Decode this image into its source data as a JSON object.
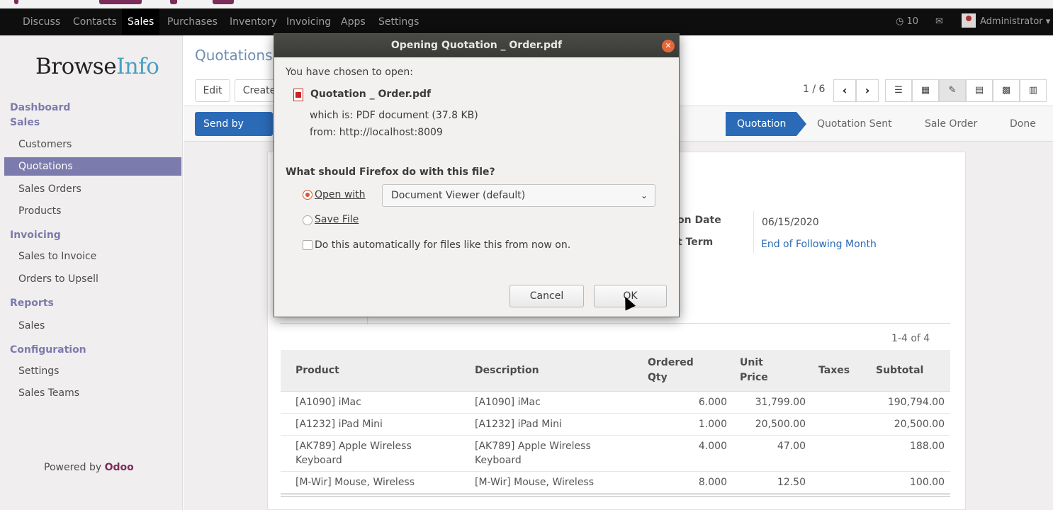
{
  "navbar": {
    "items": [
      "Discuss",
      "Contacts",
      "Sales",
      "Purchases",
      "Inventory",
      "Invoicing",
      "Apps",
      "Settings"
    ],
    "active": "Sales",
    "notifications": "10",
    "user": "Administrator"
  },
  "sidebar": {
    "logo_a": "Browse",
    "logo_b": "Info",
    "sections": {
      "dashboard": "Dashboard",
      "sales": "Sales",
      "invoicing": "Invoicing",
      "reports": "Reports",
      "configuration": "Configuration"
    },
    "items": {
      "customers": "Customers",
      "quotations": "Quotations",
      "sales_orders": "Sales Orders",
      "products": "Products",
      "sales_to_invoice": "Sales to Invoice",
      "orders_to_upsell": "Orders to Upsell",
      "reports_sales": "Sales",
      "settings": "Settings",
      "sales_teams": "Sales Teams"
    },
    "powered_by": "Powered by",
    "powered_brand": "Odoo"
  },
  "control_panel": {
    "breadcrumb": "Quotations",
    "edit": "Edit",
    "create": "Create",
    "pager": "1 / 6"
  },
  "statusbar": {
    "send_by_email": "Send by Email",
    "stages": [
      "Quotation",
      "Quotation Sent",
      "Sale Order",
      "Done"
    ],
    "active_stage": "Quotation"
  },
  "form": {
    "date_label": "on Date",
    "date_value": "06/15/2020",
    "term_label": "t Term",
    "term_value": "End of Following Month",
    "record_count": "1-4 of 4"
  },
  "order_lines": {
    "headers": {
      "product": "Product",
      "description": "Description",
      "qty_1": "Ordered",
      "qty_2": "Qty",
      "price_1": "Unit",
      "price_2": "Price",
      "taxes": "Taxes",
      "subtotal": "Subtotal"
    },
    "rows": [
      {
        "product": "[A1090] iMac",
        "description": "[A1090] iMac",
        "qty": "6.000",
        "price": "31,799.00",
        "taxes": "",
        "subtotal": "190,794.00"
      },
      {
        "product": "[A1232] iPad Mini",
        "description": "[A1232] iPad Mini",
        "qty": "1.000",
        "price": "20,500.00",
        "taxes": "",
        "subtotal": "20,500.00"
      },
      {
        "product": "[AK789] Apple Wireless Keyboard",
        "description": "[AK789] Apple Wireless Keyboard",
        "qty": "4.000",
        "price": "47.00",
        "taxes": "",
        "subtotal": "188.00"
      },
      {
        "product": "[M-Wir] Mouse, Wireless",
        "description": "[M-Wir] Mouse, Wireless",
        "qty": "8.000",
        "price": "12.50",
        "taxes": "",
        "subtotal": "100.00"
      }
    ]
  },
  "dialog": {
    "title": "Opening Quotation _ Order.pdf",
    "chosen": "You have chosen to open:",
    "filename": "Quotation _ Order.pdf",
    "which_is": "which is: PDF document (37.8 KB)",
    "from": "from: http://localhost:8009",
    "question": "What should Firefox do with this file?",
    "open_with": "Open with",
    "open_with_app": "Document Viewer (default)",
    "save_file": "Save File",
    "auto": "Do this automatically for files like this from now on.",
    "cancel": "Cancel",
    "ok": "OK"
  },
  "colors": {
    "odoo_purple": "#7c7bad",
    "primary_blue": "#2a6ab7",
    "brand": "#7c2c5a"
  }
}
